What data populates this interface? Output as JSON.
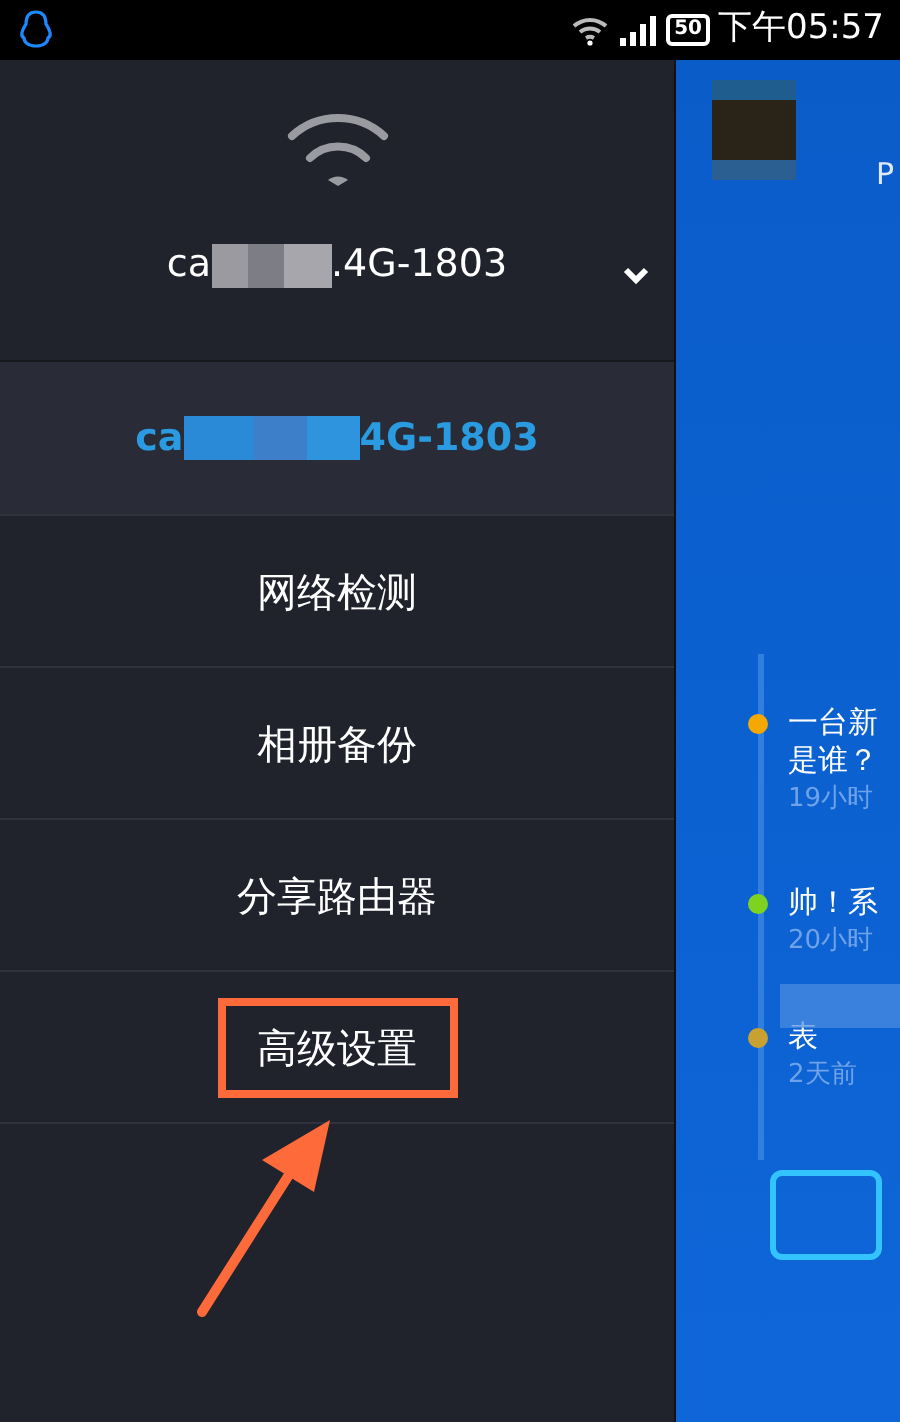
{
  "status_bar": {
    "time": "下午05:57",
    "battery": "50"
  },
  "drawer": {
    "network": {
      "name_start": "ca",
      "name_end": ".4G-1803",
      "expanded": false
    },
    "connected": {
      "name_start": "ca",
      "name_end": "4G-1803"
    },
    "menu": [
      {
        "label": "网络检测",
        "highlighted": false
      },
      {
        "label": "相册备份",
        "highlighted": false
      },
      {
        "label": "分享路由器",
        "highlighted": false
      },
      {
        "label": "高级设置",
        "highlighted": true
      }
    ]
  },
  "panel": {
    "header_text": "P",
    "timeline": [
      {
        "title": "一台新",
        "title_line2": "是谁？",
        "time": "19小时",
        "color": "#f5a800"
      },
      {
        "title": "帅！系",
        "time": "20小时",
        "color": "#7ed321"
      },
      {
        "title": "表",
        "time": "2天前",
        "color": "#c9a132"
      }
    ]
  }
}
